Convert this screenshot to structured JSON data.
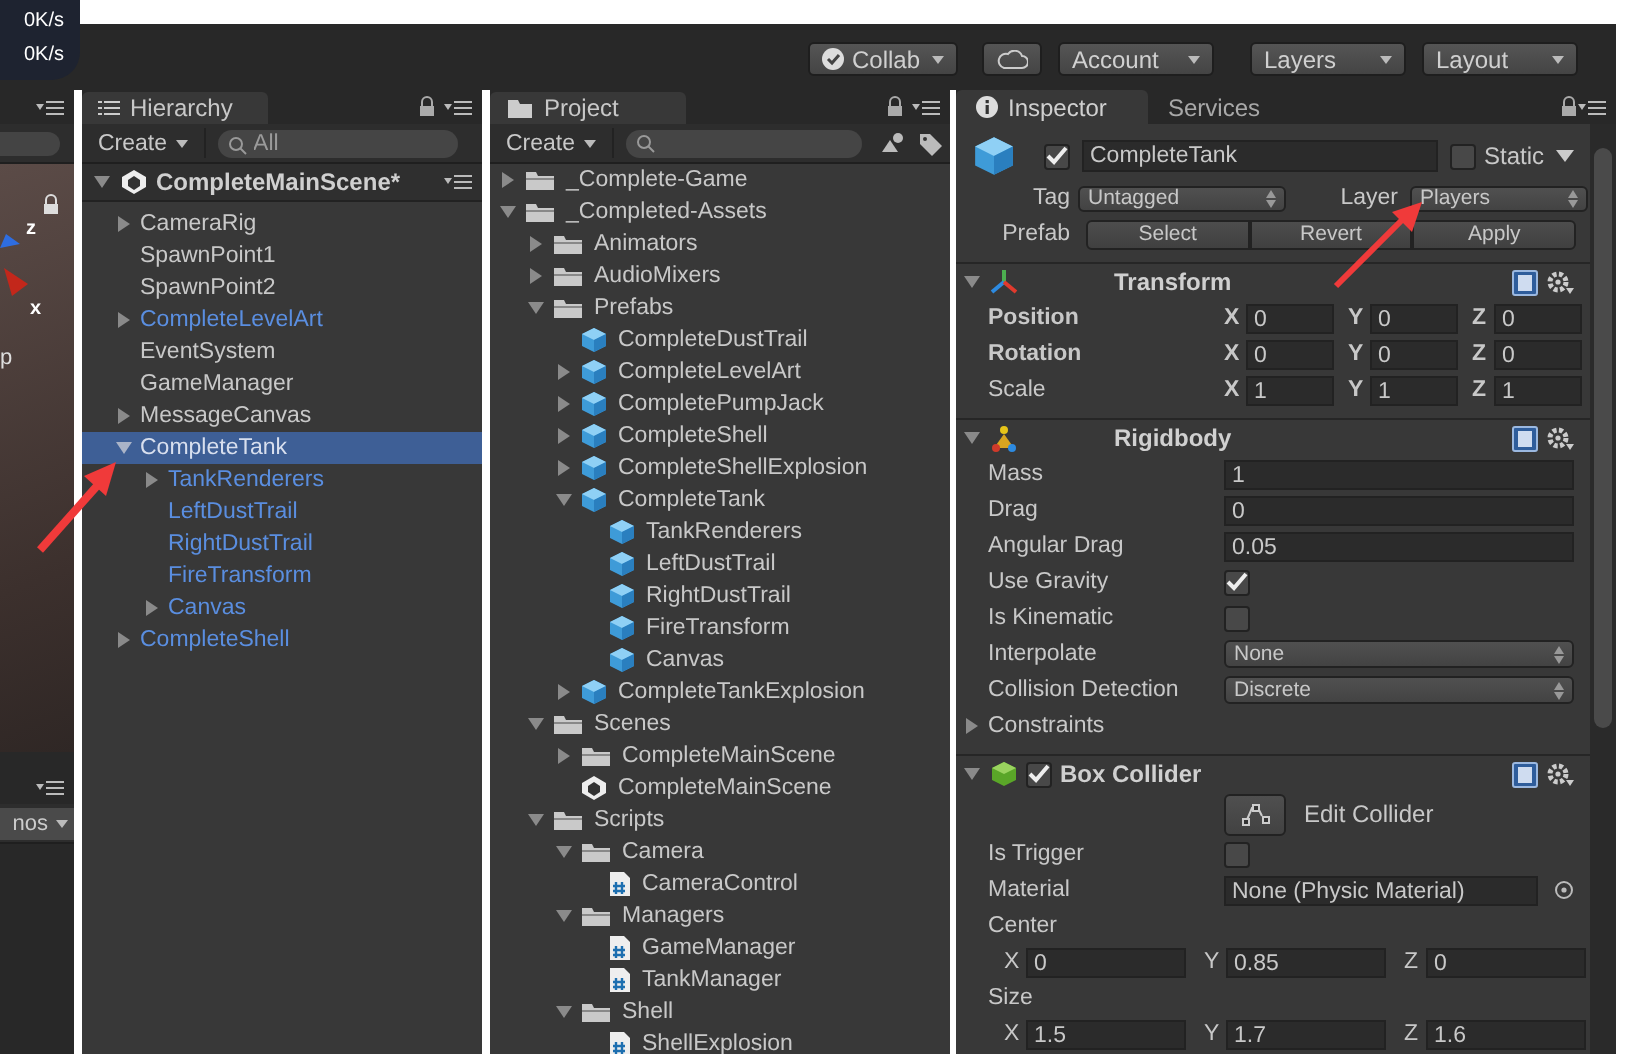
{
  "net_speed": [
    "0K/s",
    "0K/s"
  ],
  "toolbar": {
    "collab": "Collab",
    "account": "Account",
    "layers": "Layers",
    "layout": "Layout"
  },
  "scene": {
    "labels": [
      "z",
      "x",
      "p"
    ],
    "gizmos_button": "nos"
  },
  "hierarchy": {
    "title": "Hierarchy",
    "create": "Create",
    "search_placeholder": "All",
    "scene_name": "CompleteMainScene*",
    "items": [
      {
        "label": "CameraRig",
        "kind": "object",
        "expanded": false,
        "selected": false
      },
      {
        "label": "SpawnPoint1",
        "kind": "object",
        "selected": false
      },
      {
        "label": "SpawnPoint2",
        "kind": "object",
        "selected": false
      },
      {
        "label": "CompleteLevelArt",
        "kind": "prefab",
        "expanded": false,
        "selected": false
      },
      {
        "label": "EventSystem",
        "kind": "object",
        "selected": false
      },
      {
        "label": "GameManager",
        "kind": "object",
        "selected": false
      },
      {
        "label": "MessageCanvas",
        "kind": "object",
        "expanded": false,
        "selected": false
      },
      {
        "label": "CompleteTank",
        "kind": "prefab",
        "expanded": true,
        "selected": true,
        "children": [
          {
            "label": "TankRenderers",
            "kind": "prefab",
            "expanded": false,
            "selected": false
          },
          {
            "label": "LeftDustTrail",
            "kind": "prefab",
            "selected": false
          },
          {
            "label": "RightDustTrail",
            "kind": "prefab",
            "selected": false
          },
          {
            "label": "FireTransform",
            "kind": "prefab",
            "selected": false
          },
          {
            "label": "Canvas",
            "kind": "prefab",
            "expanded": false,
            "selected": false
          }
        ]
      },
      {
        "label": "CompleteShell",
        "kind": "prefab",
        "expanded": false,
        "selected": false
      }
    ]
  },
  "project": {
    "title": "Project",
    "create": "Create",
    "items": [
      {
        "label": "_Complete-Game",
        "kind": "folder",
        "expanded": false
      },
      {
        "label": "_Completed-Assets",
        "kind": "folder",
        "expanded": true,
        "children": [
          {
            "label": "Animators",
            "kind": "folder",
            "expanded": false
          },
          {
            "label": "AudioMixers",
            "kind": "folder",
            "expanded": false
          },
          {
            "label": "Prefabs",
            "kind": "folder",
            "expanded": true,
            "children": [
              {
                "label": "CompleteDustTrail",
                "kind": "prefab"
              },
              {
                "label": "CompleteLevelArt",
                "kind": "prefab",
                "expanded": false
              },
              {
                "label": "CompletePumpJack",
                "kind": "prefab",
                "expanded": false
              },
              {
                "label": "CompleteShell",
                "kind": "prefab",
                "expanded": false
              },
              {
                "label": "CompleteShellExplosion",
                "kind": "prefab",
                "expanded": false
              },
              {
                "label": "CompleteTank",
                "kind": "prefab",
                "expanded": true,
                "children": [
                  {
                    "label": "TankRenderers",
                    "kind": "prefab"
                  },
                  {
                    "label": "LeftDustTrail",
                    "kind": "prefab"
                  },
                  {
                    "label": "RightDustTrail",
                    "kind": "prefab"
                  },
                  {
                    "label": "FireTransform",
                    "kind": "prefab"
                  },
                  {
                    "label": "Canvas",
                    "kind": "prefab"
                  }
                ]
              },
              {
                "label": "CompleteTankExplosion",
                "kind": "prefab",
                "expanded": false
              }
            ]
          },
          {
            "label": "Scenes",
            "kind": "folder",
            "expanded": true,
            "children": [
              {
                "label": "CompleteMainScene",
                "kind": "folder",
                "expanded": false
              },
              {
                "label": "CompleteMainScene",
                "kind": "scene"
              }
            ]
          },
          {
            "label": "Scripts",
            "kind": "folder",
            "expanded": true,
            "children": [
              {
                "label": "Camera",
                "kind": "folder",
                "expanded": true,
                "children": [
                  {
                    "label": "CameraControl",
                    "kind": "script"
                  }
                ]
              },
              {
                "label": "Managers",
                "kind": "folder",
                "expanded": true,
                "children": [
                  {
                    "label": "GameManager",
                    "kind": "script"
                  },
                  {
                    "label": "TankManager",
                    "kind": "script"
                  }
                ]
              },
              {
                "label": "Shell",
                "kind": "folder",
                "expanded": true,
                "children": [
                  {
                    "label": "ShellExplosion",
                    "kind": "script"
                  }
                ]
              }
            ]
          }
        ]
      }
    ]
  },
  "inspector": {
    "tabs": [
      {
        "label": "Inspector",
        "selected": true
      },
      {
        "label": "Services",
        "selected": false
      }
    ],
    "object": {
      "active": true,
      "name": "CompleteTank",
      "static": false,
      "static_label": "Static"
    },
    "tag_label": "Tag",
    "tag": "Untagged",
    "layer_label": "Layer",
    "layer": "Players",
    "prefab_label": "Prefab",
    "prefab_buttons": [
      "Select",
      "Revert",
      "Apply"
    ],
    "components": [
      {
        "kind": "transform",
        "title": "Transform",
        "expanded": true,
        "fields": [
          {
            "kind": "vector3",
            "label": "Position",
            "overridden": true,
            "axes": [
              {
                "axis": "X",
                "value": "0"
              },
              {
                "axis": "Y",
                "value": "0"
              },
              {
                "axis": "Z",
                "value": "0"
              }
            ]
          },
          {
            "kind": "vector3",
            "label": "Rotation",
            "overridden": true,
            "axes": [
              {
                "axis": "X",
                "value": "0"
              },
              {
                "axis": "Y",
                "value": "0"
              },
              {
                "axis": "Z",
                "value": "0"
              }
            ]
          },
          {
            "kind": "vector3",
            "label": "Scale",
            "overridden": false,
            "axes": [
              {
                "axis": "X",
                "value": "1"
              },
              {
                "axis": "Y",
                "value": "1"
              },
              {
                "axis": "Z",
                "value": "1"
              }
            ]
          }
        ]
      },
      {
        "kind": "rigidbody",
        "title": "Rigidbody",
        "expanded": true,
        "fields": [
          {
            "kind": "number",
            "label": "Mass",
            "value": "1"
          },
          {
            "kind": "number",
            "label": "Drag",
            "value": "0"
          },
          {
            "kind": "number",
            "label": "Angular Drag",
            "value": "0.05"
          },
          {
            "kind": "checkbox",
            "label": "Use Gravity",
            "checked": true
          },
          {
            "kind": "checkbox",
            "label": "Is Kinematic",
            "checked": false
          },
          {
            "kind": "dropdown",
            "label": "Interpolate",
            "value": "None"
          },
          {
            "kind": "dropdown",
            "label": "Collision Detection",
            "value": "Discrete"
          },
          {
            "kind": "foldout",
            "label": "Constraints",
            "expanded": false
          }
        ]
      },
      {
        "kind": "box_collider",
        "title": "Box Collider",
        "expanded": true,
        "enabled": true,
        "fields": [
          {
            "kind": "button",
            "label": "Edit Collider"
          },
          {
            "kind": "checkbox",
            "label": "Is Trigger",
            "checked": false
          },
          {
            "kind": "object",
            "label": "Material",
            "value": "None (Physic Material)"
          },
          {
            "kind": "vector3_block",
            "label": "Center",
            "axes": [
              {
                "axis": "X",
                "value": "0"
              },
              {
                "axis": "Y",
                "value": "0.85"
              },
              {
                "axis": "Z",
                "value": "0"
              }
            ]
          },
          {
            "kind": "vector3_block",
            "label": "Size",
            "axes": [
              {
                "axis": "X",
                "value": "1.5"
              },
              {
                "axis": "Y",
                "value": "1.7"
              },
              {
                "axis": "Z",
                "value": "1.6"
              }
            ]
          }
        ]
      }
    ]
  }
}
